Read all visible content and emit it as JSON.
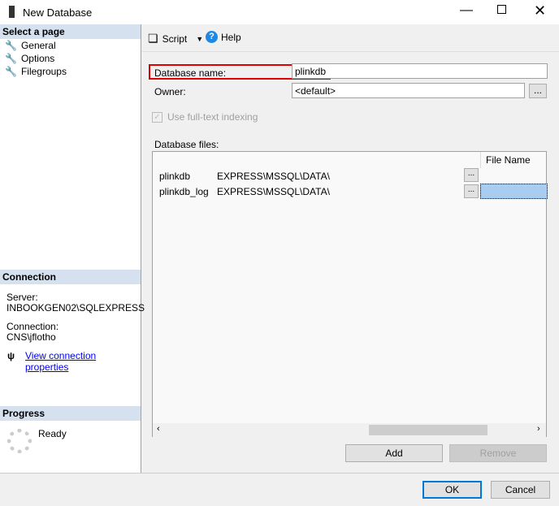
{
  "window": {
    "title": "New Database"
  },
  "sidebar": {
    "header": "Select a page",
    "items": [
      {
        "label": "General"
      },
      {
        "label": "Options"
      },
      {
        "label": "Filegroups"
      }
    ]
  },
  "connection": {
    "header": "Connection",
    "server_label": "Server:",
    "server": "INBOOKGEN02\\SQLEXPRESS",
    "connection_label": "Connection:",
    "connection": "CNS\\jflotho",
    "link": "View connection properties"
  },
  "progress": {
    "header": "Progress",
    "status": "Ready"
  },
  "toolbar": {
    "script": "Script",
    "help": "Help"
  },
  "form": {
    "db_name_label": "Database name:",
    "db_name": "plinkdb",
    "owner_label": "Owner:",
    "owner": "<default>",
    "fulltext": "Use full-text indexing",
    "files_label": "Database files:"
  },
  "files": {
    "col_file_name": "File Name",
    "rows": [
      {
        "name": "plinkdb",
        "path": "EXPRESS\\MSSQL\\DATA\\"
      },
      {
        "name": "plinkdb_log",
        "path": "EXPRESS\\MSSQL\\DATA\\"
      }
    ]
  },
  "buttons": {
    "add": "Add",
    "remove": "Remove",
    "ok": "OK",
    "cancel": "Cancel",
    "browse": "..."
  }
}
